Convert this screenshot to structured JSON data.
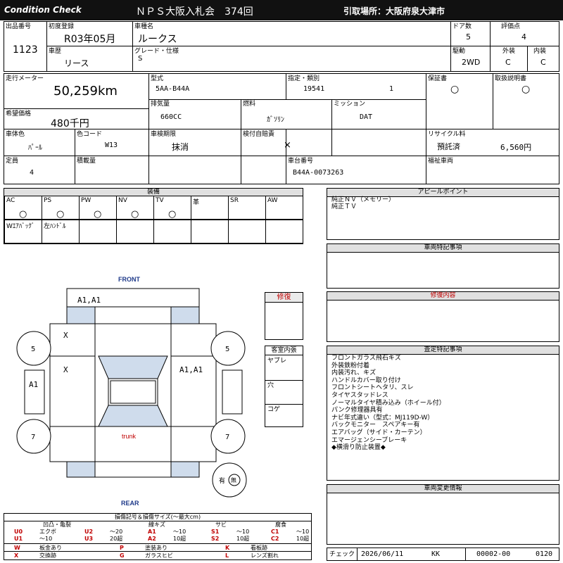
{
  "header": {
    "left": "Condition  Check",
    "center": "ＮＰＳ大阪入札会　374回",
    "right": "引取場所：大阪府泉大津市"
  },
  "lot": {
    "label": "出品番号",
    "value": "1123"
  },
  "first_reg": {
    "label": "初度登録",
    "value": "R03年05月"
  },
  "model_name": {
    "label": "車種名",
    "value": "ルークス"
  },
  "doors": {
    "label": "ドア数",
    "value": "5"
  },
  "score": {
    "label": "評価点",
    "value": "4"
  },
  "history": {
    "label": "車歴",
    "value": "リース"
  },
  "grade": {
    "label": "グレード・仕様",
    "value": "S"
  },
  "drive": {
    "label": "駆動",
    "value": "2WD"
  },
  "exterior": {
    "label": "外装",
    "value": "C"
  },
  "interior": {
    "label": "内装",
    "value": "C"
  },
  "mileage": {
    "label": "走行メーター",
    "value": "50,259km"
  },
  "price": {
    "label": "希望価格",
    "value": "480千円"
  },
  "type": {
    "label": "型式",
    "value": "5AA-B44A"
  },
  "designation": {
    "label": "指定・類別",
    "value1": "19541",
    "value2": "1"
  },
  "warranty": {
    "label": "保証書",
    "value": "○"
  },
  "manual": {
    "label": "取扱説明書",
    "value": "○"
  },
  "displacement": {
    "label": "排気量",
    "value": "660CC"
  },
  "fuel": {
    "label": "燃料",
    "value": "ｶﾞｿﾘﾝ"
  },
  "transmission": {
    "label": "ミッション",
    "value": "DAT"
  },
  "color": {
    "label": "車体色",
    "value": "ﾊﾟｰﾙ"
  },
  "color_code": {
    "label": "色コード",
    "value": "W13"
  },
  "inspection": {
    "label": "車検期限",
    "value": "抹消"
  },
  "insurance": {
    "label": "検付自賠責",
    "value": "×"
  },
  "recycle": {
    "label": "リサイクル料",
    "status": "預託済",
    "amount": "6,560円"
  },
  "capacity": {
    "label": "定員",
    "value": "4"
  },
  "load": {
    "label": "積載量",
    "value": ""
  },
  "chassis": {
    "label": "車台番号",
    "value": "B44A-0073263"
  },
  "welfare": {
    "label": "福祉車両",
    "value": ""
  },
  "equipment": {
    "title": "装備",
    "row1": [
      {
        "code": "AC",
        "mark": "○"
      },
      {
        "code": "PS",
        "mark": "○"
      },
      {
        "code": "PW",
        "mark": "○"
      },
      {
        "code": "NV",
        "mark": "○"
      },
      {
        "code": "TV",
        "mark": "○"
      },
      {
        "code": "革",
        "mark": ""
      },
      {
        "code": "SR",
        "mark": ""
      },
      {
        "code": "AW",
        "mark": ""
      }
    ],
    "row2": [
      {
        "code": "Wｴｱﾊﾞｯｸﾞ",
        "mark": ""
      },
      {
        "code": "左ﾊﾝﾄﾞﾙ",
        "mark": ""
      },
      {
        "code": "",
        "mark": ""
      },
      {
        "code": "",
        "mark": ""
      },
      {
        "code": "",
        "mark": ""
      },
      {
        "code": "",
        "mark": ""
      },
      {
        "code": "",
        "mark": ""
      },
      {
        "code": "",
        "mark": ""
      }
    ]
  },
  "appeal": {
    "title": "アピールポイント",
    "lines": [
      "純正ＮＶ（メモリー）",
      "純正ＴＶ"
    ]
  },
  "special": {
    "title": "車両特記事項",
    "lines": []
  },
  "repair": {
    "title": "修復内容",
    "lines": []
  },
  "inspector": {
    "title": "査定特記事項",
    "lines": [
      "フロントガラス飛石キズ",
      "外装鉄粉付着",
      "内装汚れ、キズ",
      "ハンドルカバー取り付け",
      "フロントシートヘタリ、スレ",
      "タイヤスタッドレス",
      "ノーマルタイヤ積み込み（ホイール付）",
      "パンク修理器具有",
      "ナビ年式違い（型式：MJ119D-W）",
      "バックモニター　スペアキー有",
      "エアバッグ（サイド・カーテン）",
      "エマージェンシーブレーキ",
      "◆横滑り防止装置◆"
    ]
  },
  "change": {
    "title": "車両変更情報",
    "lines": []
  },
  "diagram": {
    "front": "FRONT",
    "rear": "REAR",
    "trunk": "trunk",
    "marks": {
      "front_bumper": "A1,A1",
      "left_front": "X",
      "left_rear": "X",
      "right_side": "A1,A1",
      "left_sill": "A1"
    },
    "tires": {
      "fl": "5",
      "fr": "5",
      "rl": "7",
      "rr": "7"
    },
    "spare": {
      "left": "有",
      "right": "無"
    }
  },
  "repair_box": {
    "title": "修復"
  },
  "cabin": {
    "title": "客室内張",
    "items": [
      "ヤブレ",
      "穴",
      "コゲ"
    ]
  },
  "legend": {
    "title": "損傷記号＆損傷サイズ(〜最大cm)",
    "heads": [
      "凹凸・亀裂",
      "線キズ",
      "サビ",
      "腐食"
    ],
    "row1": [
      {
        "code": "U0",
        "text": "エクボ"
      },
      {
        "code": "U2",
        "text": "〜20"
      },
      {
        "code": "A1",
        "text": "〜10"
      },
      {
        "code": "S1",
        "text": "〜10"
      },
      {
        "code": "C1",
        "text": "〜10"
      }
    ],
    "row2": [
      {
        "code": "U1",
        "text": "〜10"
      },
      {
        "code": "U3",
        "text": "20超"
      },
      {
        "code": "A2",
        "text": "10超"
      },
      {
        "code": "S2",
        "text": "10超"
      },
      {
        "code": "C2",
        "text": "10超"
      }
    ],
    "row3": [
      {
        "code": "W",
        "text": "板金あり"
      },
      {
        "code": "P",
        "text": "塗装あり"
      },
      {
        "code": "K",
        "text": "看板跡"
      }
    ],
    "row4": [
      {
        "code": "X",
        "text": "交換跡"
      },
      {
        "code": "G",
        "text": "ガラスヒビ"
      },
      {
        "code": "L",
        "text": "レンズ割れ"
      }
    ]
  },
  "footer": {
    "check_label": "チェック",
    "date": "2026/06/11",
    "inspector": "KK",
    "code": "00002-00",
    "number": "0120"
  },
  "colors": {
    "header_bg": "#111111",
    "accent_red": "#c00000",
    "panel_blue": "#cfdcec"
  }
}
